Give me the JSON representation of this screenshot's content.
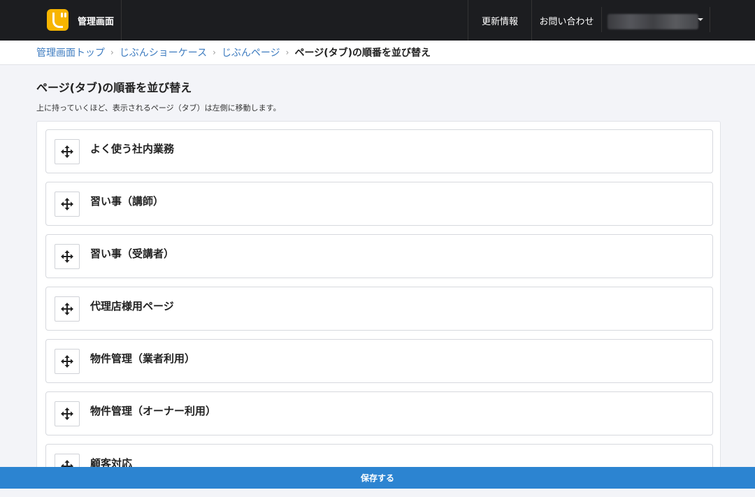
{
  "header": {
    "app_title": "管理画面",
    "nav": {
      "updates": "更新情報",
      "contact": "お問い合わせ"
    }
  },
  "breadcrumb": {
    "items": [
      "管理画面トップ",
      "じぶんショーケース",
      "じぶんページ"
    ],
    "separator": "›",
    "current": "ページ(タブ)の順番を並び替え"
  },
  "page": {
    "title": "ページ(タブ)の順番を並び替え",
    "description": "上に持っていくほど、表示されるページ（タブ）は左側に移動します。"
  },
  "sortable_list": {
    "handle_icon": "move-arrows-icon",
    "items": [
      {
        "label": "よく使う社内業務"
      },
      {
        "label": "習い事（講師）"
      },
      {
        "label": "習い事（受講者）"
      },
      {
        "label": "代理店様用ページ"
      },
      {
        "label": "物件管理（業者利用）"
      },
      {
        "label": "物件管理（オーナー利用）"
      },
      {
        "label": "顧客対応"
      }
    ]
  },
  "footer": {
    "save_label": "保存する"
  },
  "colors": {
    "topbar_bg": "#1c1d20",
    "logo_bg": "#f7b500",
    "link": "#3e7cc0",
    "save_bar": "#2c84d1",
    "page_bg": "#f3f4f8"
  }
}
